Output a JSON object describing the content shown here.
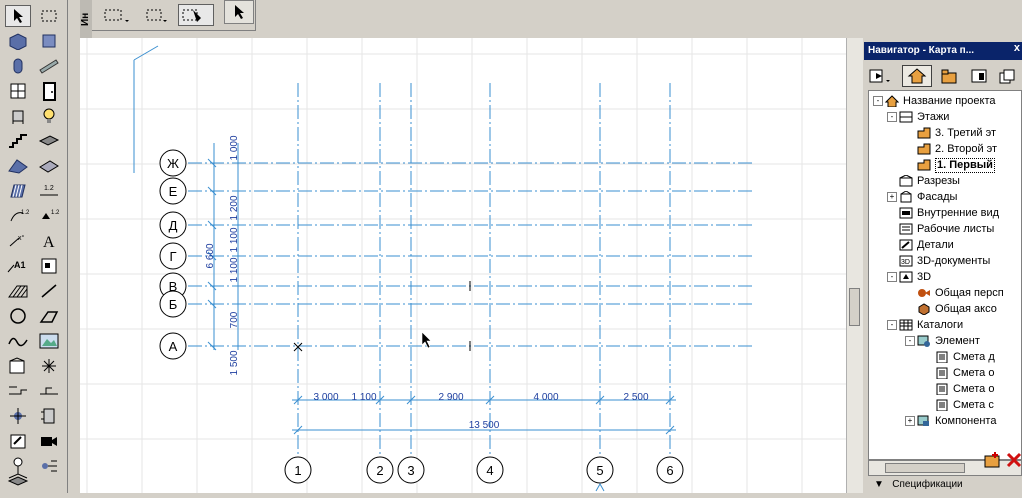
{
  "infobox": {
    "title": "Ин"
  },
  "navigator": {
    "title": "Навигатор - Карта п...",
    "close": "x",
    "tree": [
      {
        "label": "Название проекта",
        "icon": "house-icon",
        "level": 0,
        "expander": "-"
      },
      {
        "label": "Этажи",
        "icon": "stories-icon",
        "level": 1,
        "expander": "-"
      },
      {
        "label": "3. Третий эт",
        "icon": "story-icon",
        "level": 2
      },
      {
        "label": "2. Второй эт",
        "icon": "story-icon",
        "level": 2
      },
      {
        "label": "1. Первый",
        "icon": "story-icon",
        "level": 2,
        "bold": true
      },
      {
        "label": "Разрезы",
        "icon": "section-icon",
        "level": 1
      },
      {
        "label": "Фасады",
        "icon": "elevation-icon",
        "level": 1,
        "expander": "+"
      },
      {
        "label": "Внутренние вид",
        "icon": "interior-icon",
        "level": 1
      },
      {
        "label": "Рабочие листы",
        "icon": "worksheet-icon",
        "level": 1
      },
      {
        "label": "Детали",
        "icon": "detail-icon",
        "level": 1
      },
      {
        "label": "3D-документы",
        "icon": "doc3d-icon",
        "level": 1
      },
      {
        "label": "3D",
        "icon": "3d-icon",
        "level": 1,
        "expander": "-"
      },
      {
        "label": "Общая персп",
        "icon": "perspective-icon",
        "level": 2
      },
      {
        "label": "Общая аксо",
        "icon": "axo-icon",
        "level": 2
      },
      {
        "label": "Каталоги",
        "icon": "catalog-icon",
        "level": 1,
        "expander": "-"
      },
      {
        "label": "Элемент",
        "icon": "element-icon",
        "level": 2,
        "expander": "-"
      },
      {
        "label": "Смета д",
        "icon": "list-icon",
        "level": 3
      },
      {
        "label": "Смета о",
        "icon": "list-icon",
        "level": 3
      },
      {
        "label": "Смета о",
        "icon": "list-icon",
        "level": 3
      },
      {
        "label": "Смета с",
        "icon": "list-icon",
        "level": 3
      },
      {
        "label": "Компонента",
        "icon": "component-icon",
        "level": 2,
        "expander": "+"
      }
    ],
    "spec_label": "Спецификации",
    "spec_arrow": "▼"
  },
  "drawing": {
    "row_axes": [
      "Ж",
      "Е",
      "Д",
      "Г",
      "В",
      "Б",
      "А"
    ],
    "col_axes": [
      "1",
      "2",
      "3",
      "4",
      "5",
      "6"
    ],
    "vertical_dims": [
      "1 000",
      "1 200",
      "1 100",
      "1 100",
      "700",
      "1 500"
    ],
    "vertical_total": "6 600",
    "horizontal_dims": [
      "3 000",
      "1 100",
      "2 900",
      "4 000",
      "2 500"
    ],
    "horizontal_total": "13 500"
  },
  "toolbox": {
    "text_tool_label": "A",
    "label_tool_label": "A1"
  },
  "colors": {
    "grid_line": "#3a8fd0",
    "dim_text": "#2040a0",
    "nav_title_bg": "#0a246a"
  }
}
